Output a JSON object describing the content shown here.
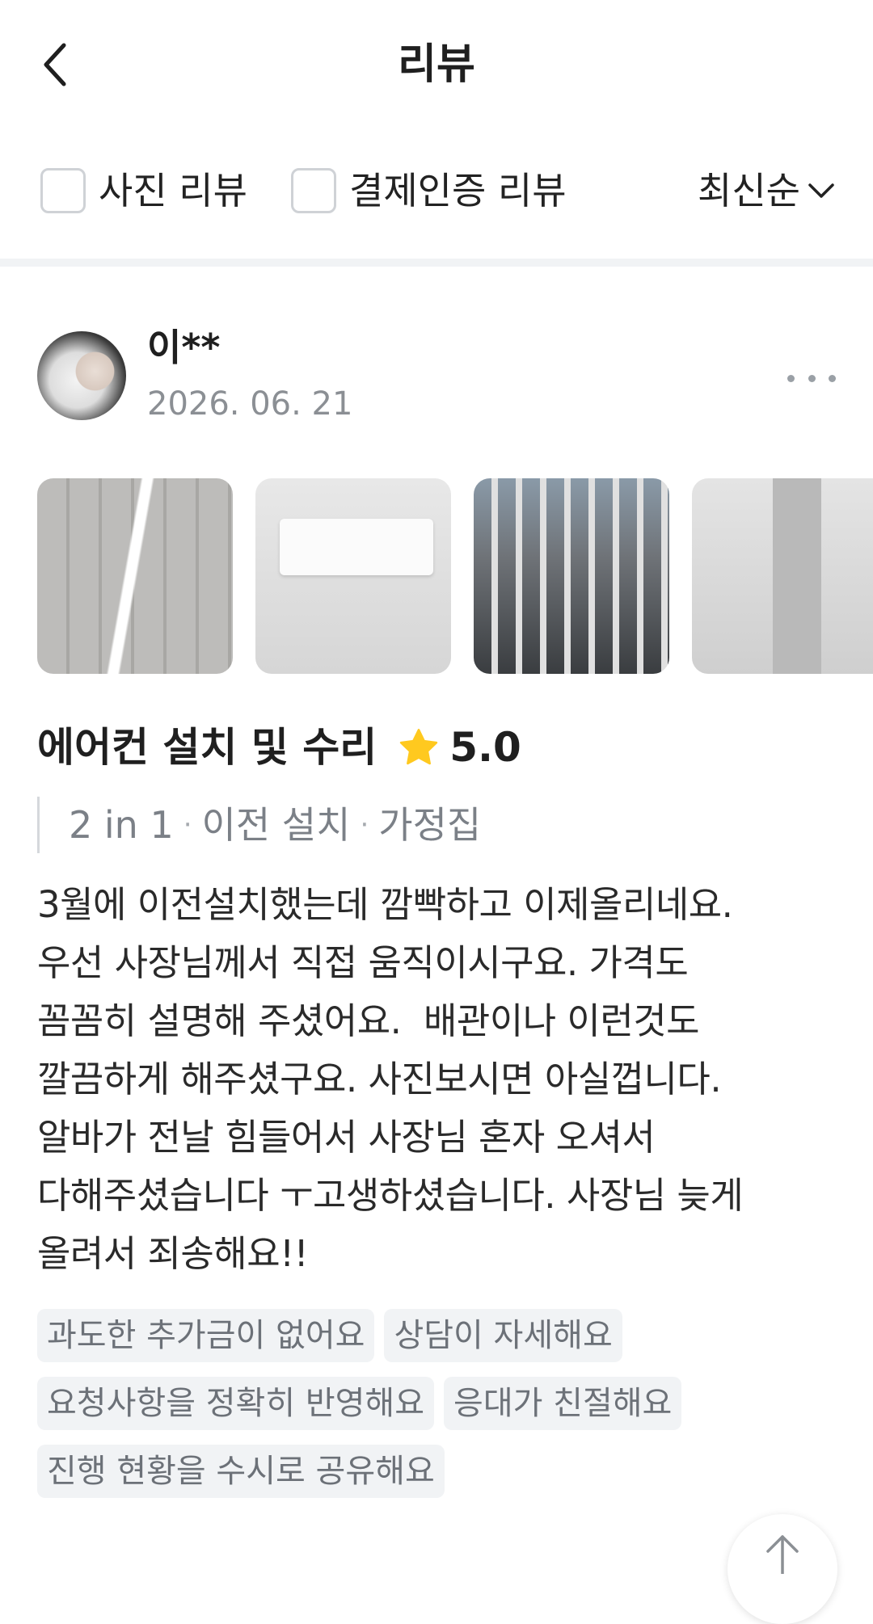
{
  "header": {
    "title": "리뷰",
    "back_icon": "chevron-left-icon"
  },
  "filters": {
    "photo_review_label": "사진 리뷰",
    "photo_review_checked": false,
    "payment_review_label": "결제인증 리뷰",
    "payment_review_checked": false,
    "sort_label": "최신순",
    "sort_icon": "chevron-down-icon"
  },
  "review": {
    "author": "이**",
    "date": "2026. 06. 21",
    "more_icon": "more-horizontal-icon",
    "photos_count_visible": 4,
    "service_title": "에어컨 설치 및 수리",
    "rating": "5.0",
    "star_color": "#FFC91F",
    "options": [
      "2 in 1",
      "이전 설치",
      "가정집"
    ],
    "option_separator": "·",
    "text": "3월에 이전설치했는데 깜빡하고 이제올리네요.\n우선 사장님께서 직접 움직이시구요. 가격도\n꼼꼼히 설명해 주셨어요.  배관이나 이런것도\n깔끔하게 해주셨구요. 사진보시면 아실껍니다.\n알바가 전날 힘들어서 사장님 혼자 오셔서\n다해주셨습니다 ㅜ고생하셨습니다. 사장님 늦게\n올려서 죄송해요!!",
    "tags": [
      [
        "과도한 추가금이 없어요",
        "상담이 자세해요"
      ],
      [
        "요청사항을 정확히 반영해요",
        "응대가 친절해요"
      ],
      [
        "진행 현황을 수시로 공유해요"
      ]
    ]
  },
  "scroll_top_icon": "arrow-up-icon"
}
